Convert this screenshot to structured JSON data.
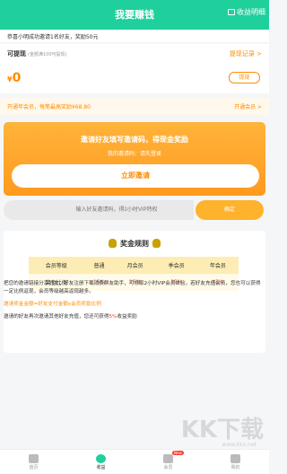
{
  "header": {
    "title": "我要赚钱",
    "right_label": "收益明细"
  },
  "notice": "恭喜小明成功邀请1名好友，奖励50元",
  "withdraw": {
    "label": "可提现",
    "sub": "(金额满100可提现)",
    "record_link": "提现记录 >",
    "currency": "¥",
    "amount": "0",
    "button": "提现"
  },
  "vip_bar": {
    "left": "开通年会员，每笔最高奖励¥68.80",
    "right": "开通会员 >"
  },
  "invite": {
    "title": "邀请好友填写邀请码，得现金奖励",
    "code_prefix": "我的邀请码：",
    "code_value": "请先登录",
    "button": "立即邀请"
  },
  "code_entry": {
    "placeholder": "输入好友邀请码，得2小时VIP特权",
    "button": "确定"
  },
  "rules": {
    "title": "奖金规则",
    "headers": [
      "会员等级",
      "普通",
      "月会员",
      "季会员",
      "年会员"
    ],
    "row_label": "奖金比例",
    "row_values": [
      "15%",
      "25%",
      "35%",
      "45%"
    ],
    "text_1": "把您的邀请链接分享好友，好友注册下载消费群友助手，可领取2小时VIP会员体验，若好友充值会员，您也可以获得一定比例返现，会员等级越高返现越多。",
    "text_2": "邀请奖金金额=好友支付金额x会员奖励比例",
    "text_3_a": "邀请的好友再次邀请其他好友充值，您还可获得",
    "text_3_b": "5%",
    "text_3_c": "收益奖励"
  },
  "tabbar": {
    "items": [
      {
        "label": "首页"
      },
      {
        "label": "收益"
      },
      {
        "label": "会员",
        "badge": "New"
      },
      {
        "label": "我的"
      }
    ]
  },
  "watermark": {
    "text": "KK下载",
    "url": "www.kkx.net"
  },
  "colors": {
    "brand": "#1fcf9c",
    "accent": "#ff8c00"
  }
}
